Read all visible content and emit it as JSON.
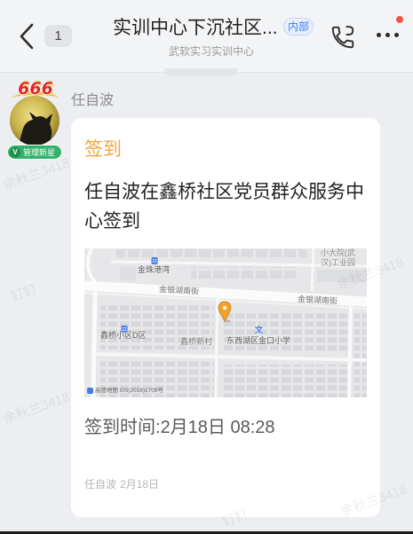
{
  "header": {
    "back_icon": "chevron-left-icon",
    "unread_count": "1",
    "title": "实训中心下沉社区...",
    "tag": "内部",
    "subtitle": "武软实习实训中心",
    "call_icon": "phone-call-icon",
    "more_icon": "more-dots-icon",
    "notification_dot": true
  },
  "message": {
    "sender_name": "任自波",
    "avatar": {
      "frame_text": "666",
      "badge_letter": "V",
      "badge_text": "管理新星"
    },
    "card": {
      "type_label": "签到",
      "content": "任自波在鑫桥社区党员群众服务中心签到",
      "map": {
        "pin_icon": "location-pin-icon",
        "labels": [
          {
            "text": "金珠港湾",
            "icon": "building-icon"
          },
          {
            "text": "小大院(武汉)工业园"
          },
          {
            "text": "金银湖南街"
          },
          {
            "text": "金银湖南街"
          },
          {
            "text": "鑫桥小区D区",
            "icon": "building-icon"
          },
          {
            "text": "鑫桥新村"
          },
          {
            "text": "东西湖区金口小学",
            "icon": "school-icon"
          }
        ],
        "school_icon_glyph": "文",
        "attribution": "高德地图 GS(2018)1709号"
      },
      "time_label": "签到时间:",
      "time_value": "2月18日 08:28",
      "footer_author": "任自波",
      "footer_date": "2月18日"
    }
  },
  "watermark": {
    "user": "余秋兰3418",
    "app": "钉钉"
  },
  "colors": {
    "page_background": "#eceef1",
    "card_background": "#ffffff",
    "checkin_orange": "#f2a43b",
    "tag_blue": "#3b7bf6",
    "badge_green": "#34b16a",
    "notification_red": "#f25643"
  }
}
